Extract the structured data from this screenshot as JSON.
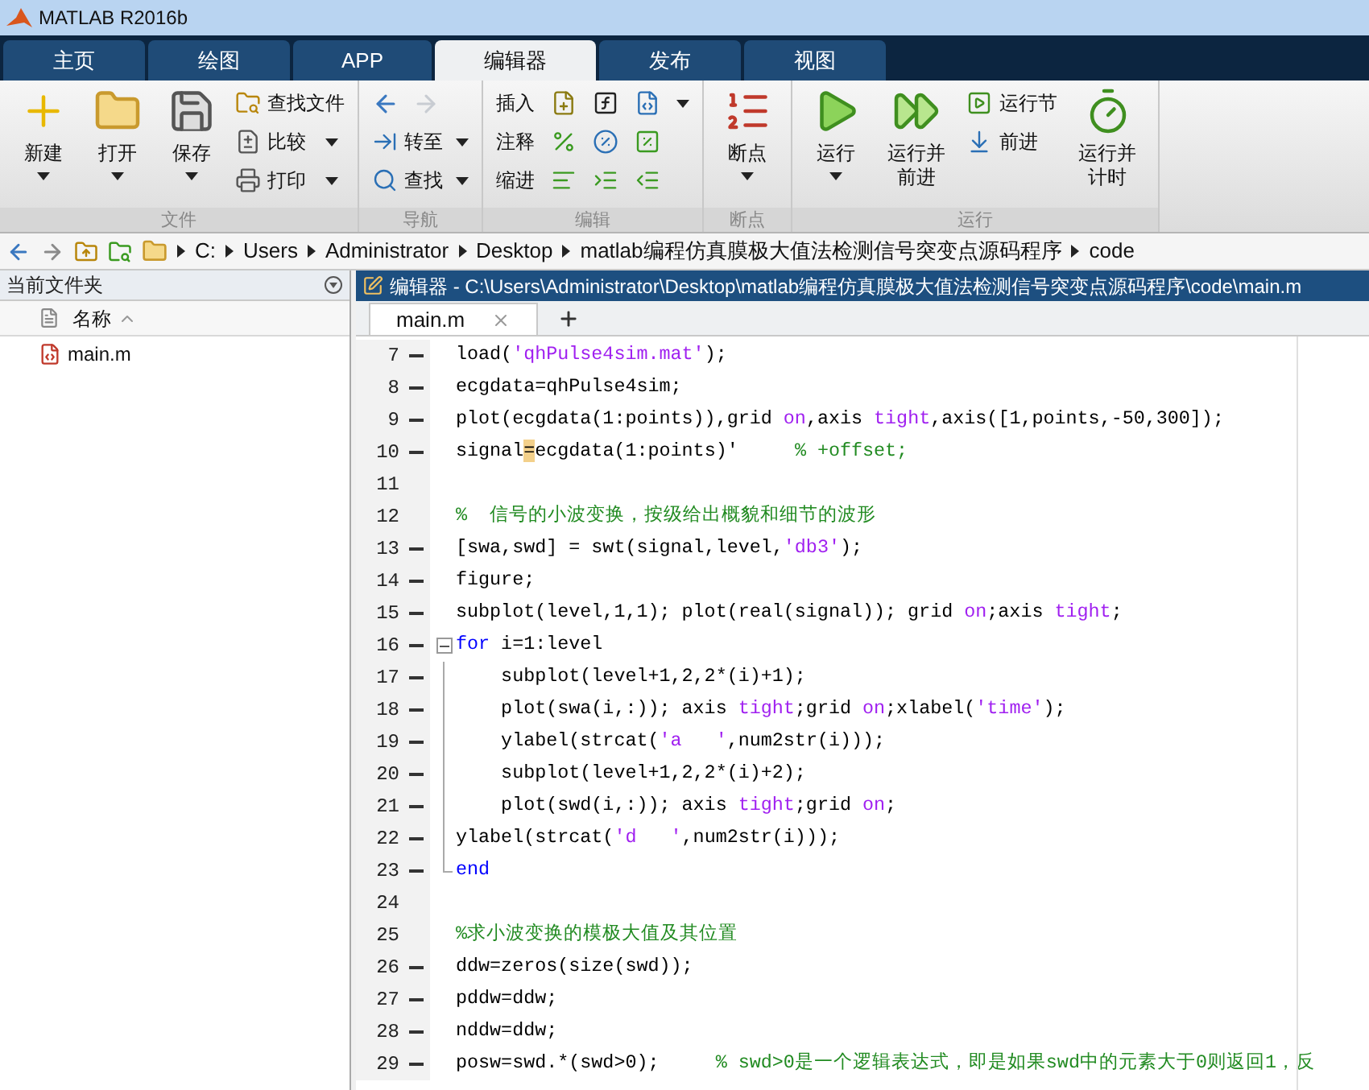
{
  "window": {
    "title": "MATLAB R2016b"
  },
  "tabs": [
    {
      "label": "主页",
      "selected": false
    },
    {
      "label": "绘图",
      "selected": false
    },
    {
      "label": "APP",
      "selected": false
    },
    {
      "label": "编辑器",
      "selected": true
    },
    {
      "label": "发布",
      "selected": false
    },
    {
      "label": "视图",
      "selected": false
    }
  ],
  "ribbon": {
    "groups": [
      {
        "label": "文件",
        "columns": [
          {
            "kind": "large",
            "label": "新建",
            "dropdown": true
          },
          {
            "kind": "large",
            "label": "打开",
            "dropdown": true
          },
          {
            "kind": "large",
            "label": "保存",
            "dropdown": true
          },
          {
            "kind": "stack",
            "items": [
              {
                "label": "查找文件",
                "dropdown": false
              },
              {
                "label": "比较",
                "dropdown": true
              },
              {
                "label": "打印",
                "dropdown": true
              }
            ]
          }
        ]
      },
      {
        "label": "导航",
        "columns": [
          {
            "kind": "nav",
            "arrows": [
              {
                "disabled": false
              },
              {
                "disabled": true
              }
            ],
            "items": [
              {
                "label": "转至",
                "dropdown": true
              },
              {
                "label": "查找",
                "dropdown": true
              }
            ]
          }
        ]
      },
      {
        "label": "编辑",
        "columns": [
          {
            "kind": "grid",
            "rows": [
              {
                "label": "插入",
                "dropdown": true
              },
              {
                "label": "注释",
                "dropdown": false
              },
              {
                "label": "缩进",
                "dropdown": false
              }
            ]
          }
        ]
      },
      {
        "label": "断点",
        "columns": [
          {
            "kind": "large",
            "label": "断点",
            "dropdown": true
          }
        ]
      },
      {
        "label": "运行",
        "columns": [
          {
            "kind": "large",
            "label": "运行",
            "dropdown": true
          },
          {
            "kind": "large",
            "label": "运行并前进",
            "dropdown": false
          },
          {
            "kind": "stack",
            "items": [
              {
                "label": "运行节",
                "dropdown": false
              },
              {
                "label": "前进",
                "dropdown": false
              }
            ]
          },
          {
            "kind": "large",
            "label": "运行并计时",
            "dropdown": false
          }
        ]
      }
    ]
  },
  "address_bar": {
    "path": [
      "C:",
      "Users",
      "Administrator",
      "Desktop",
      "matlab编程仿真膜极大值法检测信号突变点源码程序",
      "code"
    ]
  },
  "file_panel": {
    "title": "当前文件夹",
    "column": "名称",
    "files": [
      {
        "name": "main.m"
      }
    ]
  },
  "editor": {
    "title": "编辑器 - C:\\Users\\Administrator\\Desktop\\matlab编程仿真膜极大值法检测信号突变点源码程序\\code\\main.m",
    "tabs": [
      {
        "label": "main.m",
        "selected": true
      }
    ],
    "lines": [
      {
        "number": "7",
        "executable": true,
        "tokens": [
          {
            "kind": "code",
            "text": "load("
          },
          {
            "kind": "string",
            "text": "'qhPulse4sim.mat'"
          },
          {
            "kind": "code",
            "text": ");"
          }
        ]
      },
      {
        "number": "8",
        "executable": true,
        "tokens": [
          {
            "kind": "code",
            "text": "ecgdata=qhPulse4sim;"
          }
        ]
      },
      {
        "number": "9",
        "executable": true,
        "tokens": [
          {
            "kind": "code",
            "text": "plot(ecgdata(1:points)),grid "
          },
          {
            "kind": "string",
            "text": "on"
          },
          {
            "kind": "code",
            "text": ",axis "
          },
          {
            "kind": "string",
            "text": "tight"
          },
          {
            "kind": "code",
            "text": ",axis([1,points,-50,300]);"
          }
        ]
      },
      {
        "number": "10",
        "executable": true,
        "tokens": [
          {
            "kind": "code",
            "text": "signal"
          },
          {
            "kind": "cursor",
            "text": "="
          },
          {
            "kind": "code",
            "text": "ecgdata(1:points)'     "
          },
          {
            "kind": "comment",
            "text": "% +offset;"
          }
        ]
      },
      {
        "number": "11",
        "executable": false
      },
      {
        "number": "12",
        "executable": false,
        "tokens": [
          {
            "kind": "comment",
            "text": "%  信号的小波变换，按级给出概貌和细节的波形"
          }
        ]
      },
      {
        "number": "13",
        "executable": true,
        "tokens": [
          {
            "kind": "code",
            "text": "[swa,swd] = swt(signal,level,"
          },
          {
            "kind": "string",
            "text": "'db3'"
          },
          {
            "kind": "code",
            "text": ");"
          }
        ]
      },
      {
        "number": "14",
        "executable": true,
        "tokens": [
          {
            "kind": "code",
            "text": "figure;"
          }
        ]
      },
      {
        "number": "15",
        "executable": true,
        "tokens": [
          {
            "kind": "code",
            "text": "subplot(level,1,1); plot(real(signal)); grid "
          },
          {
            "kind": "string",
            "text": "on"
          },
          {
            "kind": "code",
            "text": ";axis "
          },
          {
            "kind": "string",
            "text": "tight"
          },
          {
            "kind": "code",
            "text": ";"
          }
        ]
      },
      {
        "number": "16",
        "executable": true,
        "kind": "fold_start",
        "tokens": [
          {
            "kind": "keyword",
            "text": "for"
          },
          {
            "kind": "code",
            "text": " i=1:level"
          }
        ]
      },
      {
        "number": "17",
        "executable": true,
        "kind": "fold_body",
        "tokens": [
          {
            "kind": "code",
            "text": "    subplot(level+1,2,2*(i)+1);"
          }
        ]
      },
      {
        "number": "18",
        "executable": true,
        "kind": "fold_body",
        "tokens": [
          {
            "kind": "code",
            "text": "    plot(swa(i,:)); axis "
          },
          {
            "kind": "string",
            "text": "tight"
          },
          {
            "kind": "code",
            "text": ";grid "
          },
          {
            "kind": "string",
            "text": "on"
          },
          {
            "kind": "code",
            "text": ";xlabel("
          },
          {
            "kind": "string",
            "text": "'time'"
          },
          {
            "kind": "code",
            "text": ");"
          }
        ]
      },
      {
        "number": "19",
        "executable": true,
        "kind": "fold_body",
        "tokens": [
          {
            "kind": "code",
            "text": "    ylabel(strcat("
          },
          {
            "kind": "string",
            "text": "'a   '"
          },
          {
            "kind": "code",
            "text": ",num2str(i)));"
          }
        ]
      },
      {
        "number": "20",
        "executable": true,
        "kind": "fold_body",
        "tokens": [
          {
            "kind": "code",
            "text": "    subplot(level+1,2,2*(i)+2);"
          }
        ]
      },
      {
        "number": "21",
        "executable": true,
        "kind": "fold_body",
        "tokens": [
          {
            "kind": "code",
            "text": "    plot(swd(i,:)); axis "
          },
          {
            "kind": "string",
            "text": "tight"
          },
          {
            "kind": "code",
            "text": ";grid "
          },
          {
            "kind": "string",
            "text": "on"
          },
          {
            "kind": "code",
            "text": ";"
          }
        ]
      },
      {
        "number": "22",
        "executable": true,
        "kind": "fold_body",
        "tokens": [
          {
            "kind": "code",
            "text": "ylabel(strcat("
          },
          {
            "kind": "string",
            "text": "'d   '"
          },
          {
            "kind": "code",
            "text": ",num2str(i)));"
          }
        ]
      },
      {
        "number": "23",
        "executable": true,
        "kind": "fold_end",
        "tokens": [
          {
            "kind": "keyword",
            "text": "end"
          }
        ]
      },
      {
        "number": "24",
        "executable": false
      },
      {
        "number": "25",
        "executable": false,
        "tokens": [
          {
            "kind": "comment",
            "text": "%求小波变换的模极大值及其位置"
          }
        ]
      },
      {
        "number": "26",
        "executable": true,
        "tokens": [
          {
            "kind": "code",
            "text": "ddw=zeros(size(swd));"
          }
        ]
      },
      {
        "number": "27",
        "executable": true,
        "tokens": [
          {
            "kind": "code",
            "text": "pddw=ddw;"
          }
        ]
      },
      {
        "number": "28",
        "executable": true,
        "tokens": [
          {
            "kind": "code",
            "text": "nddw=ddw;"
          }
        ]
      },
      {
        "number": "29",
        "executable": true,
        "tokens": [
          {
            "kind": "code",
            "text": "posw=swd.*(swd>0);     "
          },
          {
            "kind": "comment",
            "text": "% swd>0是一个逻辑表达式，即是如果swd中的元素大于0则返回1，反"
          }
        ]
      }
    ]
  }
}
